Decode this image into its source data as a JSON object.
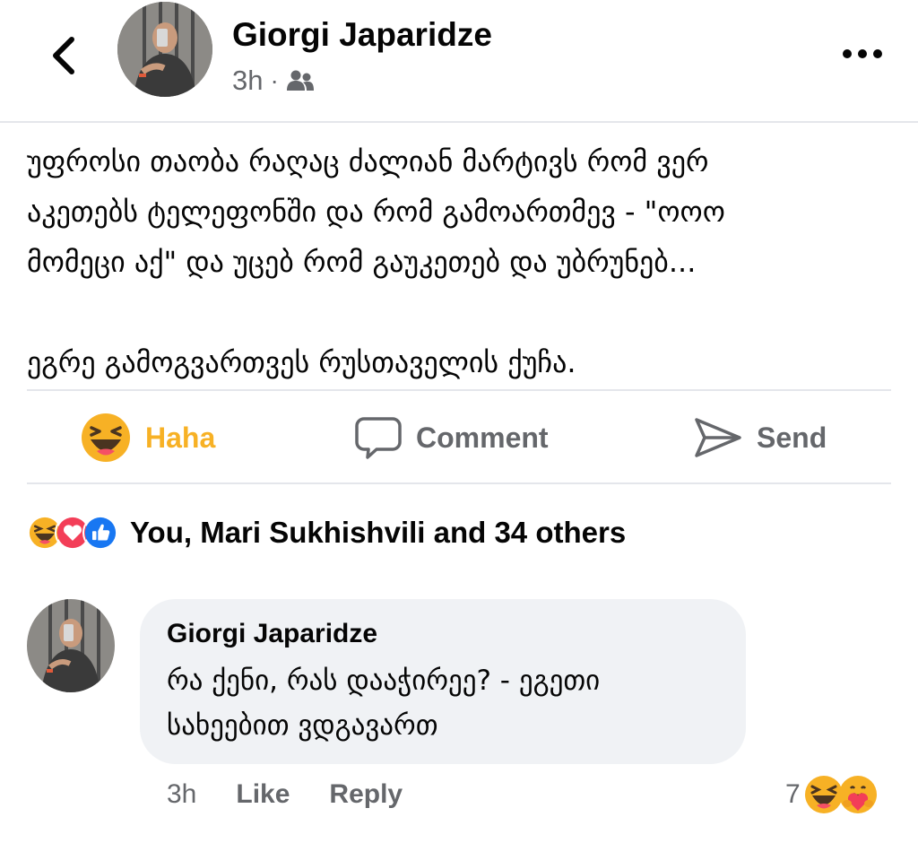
{
  "post": {
    "author": "Giorgi Japaridze",
    "time": "3h",
    "separator": "·",
    "audience_icon": "friends-icon",
    "paragraph_1_lines": [
      "უფროსი თაობა რაღაც ძალიან მარტივს რომ ვერ",
      "აკეთებს ტელეფონში და რომ გამოართმევ - \"ოოო",
      "მომეცი აქ\" და უცებ რომ გაუკეთებ და უბრუნებ..."
    ],
    "paragraph_2": "ეგრე გამოგვართვეს რუსთაველის ქუჩა."
  },
  "actions": {
    "haha_label": "Haha",
    "comment_label": "Comment",
    "send_label": "Send"
  },
  "reactions": {
    "summary": "You, Mari Sukhishvili and 34 others",
    "icons": [
      "haha-icon",
      "love-icon",
      "like-icon"
    ]
  },
  "comment": {
    "author": "Giorgi Japaridze",
    "text_lines": [
      "რა ქენი, რას დააჭირეე? - ეგეთი",
      "სახეებით ვდგავართ"
    ],
    "time": "3h",
    "like_label": "Like",
    "reply_label": "Reply",
    "reaction_count": "7",
    "reaction_icons": [
      "haha-icon",
      "care-icon"
    ]
  },
  "colors": {
    "haha": "#f7b125",
    "love": "#f33e58",
    "like": "#1877f2",
    "muted": "#65676b",
    "bubble": "#f0f2f5"
  }
}
